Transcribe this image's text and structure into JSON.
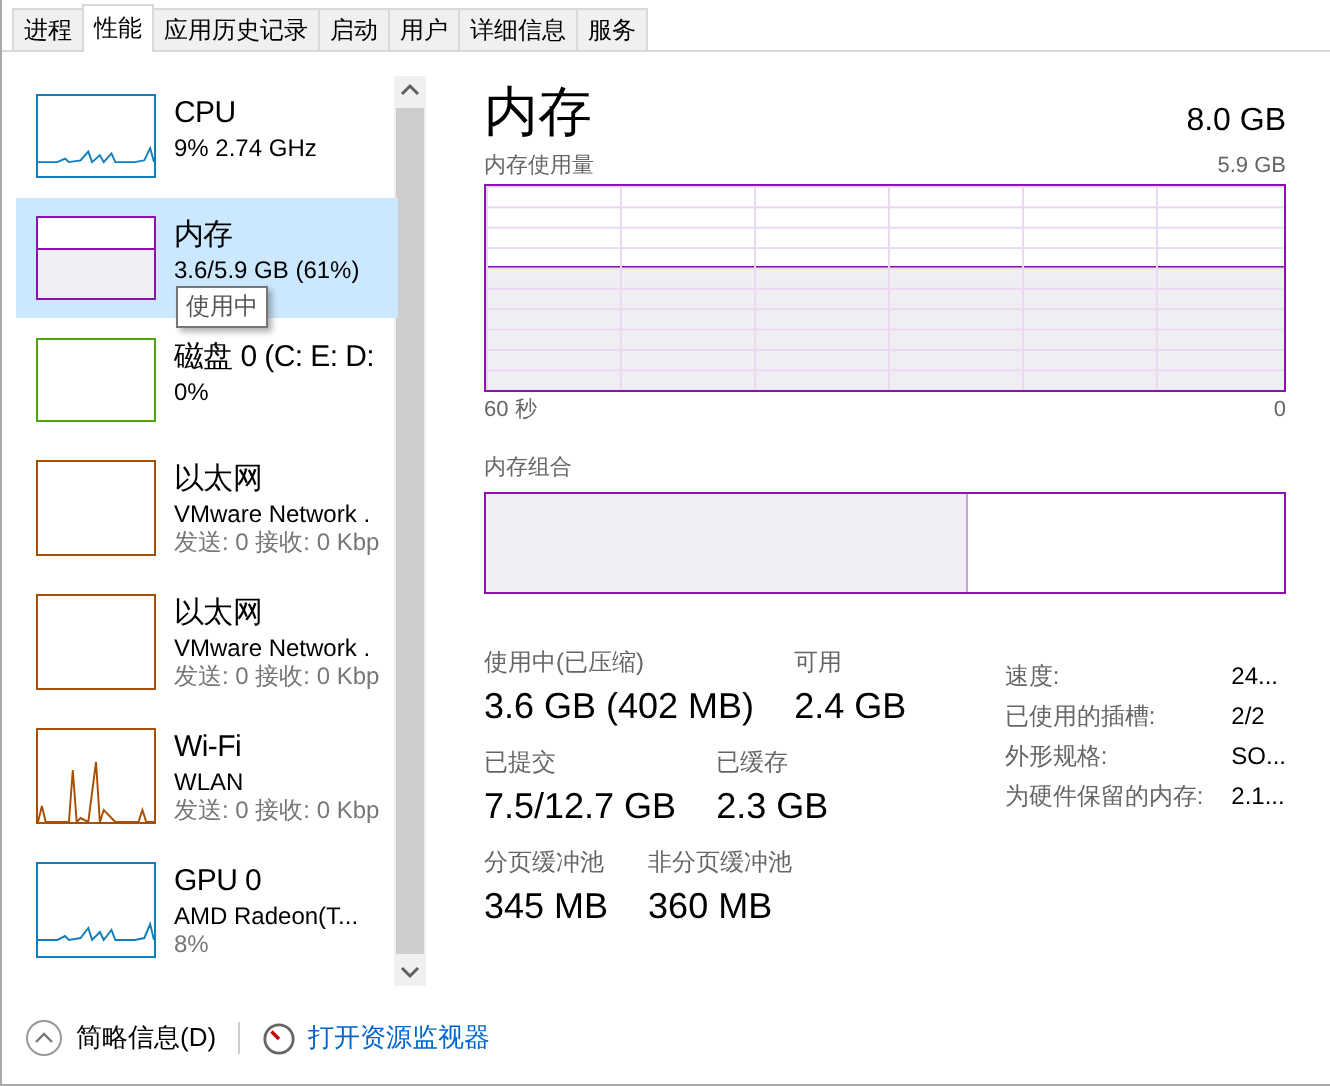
{
  "tabs": [
    {
      "label": "进程",
      "selected": false
    },
    {
      "label": "性能",
      "selected": true
    },
    {
      "label": "应用历史记录",
      "selected": false
    },
    {
      "label": "启动",
      "selected": false
    },
    {
      "label": "用户",
      "selected": false
    },
    {
      "label": "详细信息",
      "selected": false
    },
    {
      "label": "服务",
      "selected": false
    }
  ],
  "sidebar": {
    "items": [
      {
        "title": "CPU",
        "lines": [
          "9% 2.74 GHz"
        ],
        "kind": "sparkline",
        "color": "#117dbb",
        "selected": false
      },
      {
        "title": "内存",
        "lines": [
          "3.6/5.9 GB (61%)"
        ],
        "kind": "fill",
        "color": "#8b12ae",
        "selected": true,
        "tooltip": "使用中"
      },
      {
        "title": "磁盘 0 (C: E: D:",
        "lines": [
          "0%"
        ],
        "kind": "empty",
        "color": "#4da60c",
        "selected": false
      },
      {
        "title": "以太网",
        "lines": [
          "VMware Network .",
          "发送: 0 接收: 0 Kbp"
        ],
        "kind": "empty",
        "color": "#a74f01",
        "selected": false
      },
      {
        "title": "以太网",
        "lines": [
          "VMware Network .",
          "发送: 0 接收: 0 Kbp"
        ],
        "kind": "empty",
        "color": "#a74f01",
        "selected": false
      },
      {
        "title": "Wi-Fi",
        "lines": [
          "WLAN",
          "发送: 0 接收: 0 Kbp"
        ],
        "kind": "spikes",
        "color": "#a74f01",
        "selected": false
      },
      {
        "title": "GPU 0",
        "lines": [
          "AMD Radeon(T...",
          "8%"
        ],
        "kind": "sparkline",
        "color": "#117dbb",
        "selected": false
      }
    ]
  },
  "detail": {
    "title": "内存",
    "total": "8.0 GB",
    "usage_graph": {
      "label": "内存使用量",
      "max": "5.9 GB",
      "time_start": "60 秒",
      "time_end": "0"
    },
    "composition": {
      "label": "内存组合",
      "level": 0.605
    },
    "stat_rows": [
      [
        {
          "label": "使用中(已压缩)",
          "value": "3.6 GB (402 MB)"
        },
        {
          "label": "可用",
          "value": "2.4 GB"
        }
      ],
      [
        {
          "label": "已提交",
          "value": "7.5/12.7 GB"
        },
        {
          "label": "已缓存",
          "value": "2.3 GB"
        }
      ],
      [
        {
          "label": "分页缓冲池",
          "value": "345 MB"
        },
        {
          "label": "非分页缓冲池",
          "value": "360 MB"
        }
      ]
    ],
    "specs": [
      {
        "label": "速度:",
        "value": "24..."
      },
      {
        "label": "已使用的插槽:",
        "value": "2/2"
      },
      {
        "label": "外形规格:",
        "value": "SO..."
      },
      {
        "label": "为硬件保留的内存:",
        "value": "2.1..."
      }
    ]
  },
  "footer": {
    "summary": "简略信息(D)",
    "link": "打开资源监视器"
  }
}
